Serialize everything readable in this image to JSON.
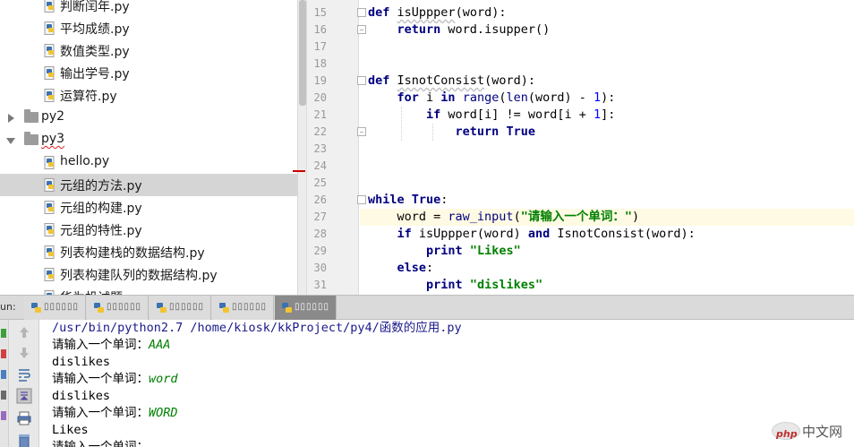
{
  "tree": {
    "items": [
      {
        "type": "file",
        "label": "判断闰年.py"
      },
      {
        "type": "file",
        "label": "平均成绩.py"
      },
      {
        "type": "file",
        "label": "数值类型.py"
      },
      {
        "type": "file",
        "label": "输出学号.py"
      },
      {
        "type": "file",
        "label": "运算符.py"
      },
      {
        "type": "folder",
        "label": "py2",
        "expanded": false
      },
      {
        "type": "folder",
        "label": "py3",
        "expanded": true
      },
      {
        "type": "file",
        "label": "hello.py"
      },
      {
        "type": "file",
        "label": "元组的方法.py",
        "selected": true
      },
      {
        "type": "file",
        "label": "元组的构建.py"
      },
      {
        "type": "file",
        "label": "元组的特性.py"
      },
      {
        "type": "file",
        "label": "列表构建栈的数据结构.py"
      },
      {
        "type": "file",
        "label": "列表构建队列的数据结构.py"
      },
      {
        "type": "file",
        "label": "华为机试题"
      }
    ]
  },
  "editor": {
    "line_numbers": [
      "15",
      "16",
      "17",
      "18",
      "19",
      "20",
      "21",
      "22",
      "23",
      "24",
      "25",
      "26",
      "27",
      "28",
      "29",
      "30",
      "31"
    ],
    "current_line": "27"
  },
  "run": {
    "label": "un:",
    "tabs": [
      "▯▯▯▯▯▯",
      "▯▯▯▯▯▯",
      "▯▯▯▯▯▯",
      "▯▯▯▯▯▯",
      "▯▯▯▯▯▯"
    ],
    "active_tab": 4
  },
  "console": {
    "lines": [
      {
        "kind": "path",
        "text": "/usr/bin/python2.7 /home/kiosk/kkProject/py4/函数的应用.py"
      },
      {
        "kind": "prompt",
        "prompt": "请输入一个单词：",
        "input": "AAA"
      },
      {
        "kind": "out",
        "text": "dislikes"
      },
      {
        "kind": "prompt",
        "prompt": "请输入一个单词：",
        "input": "word"
      },
      {
        "kind": "out",
        "text": "dislikes"
      },
      {
        "kind": "prompt",
        "prompt": "请输入一个单词：",
        "input": "WORD"
      },
      {
        "kind": "out",
        "text": "Likes"
      },
      {
        "kind": "prompt",
        "prompt": "请输入一个单词：",
        "input": ""
      }
    ]
  },
  "watermark": {
    "logo": "php",
    "text": "中文网"
  }
}
